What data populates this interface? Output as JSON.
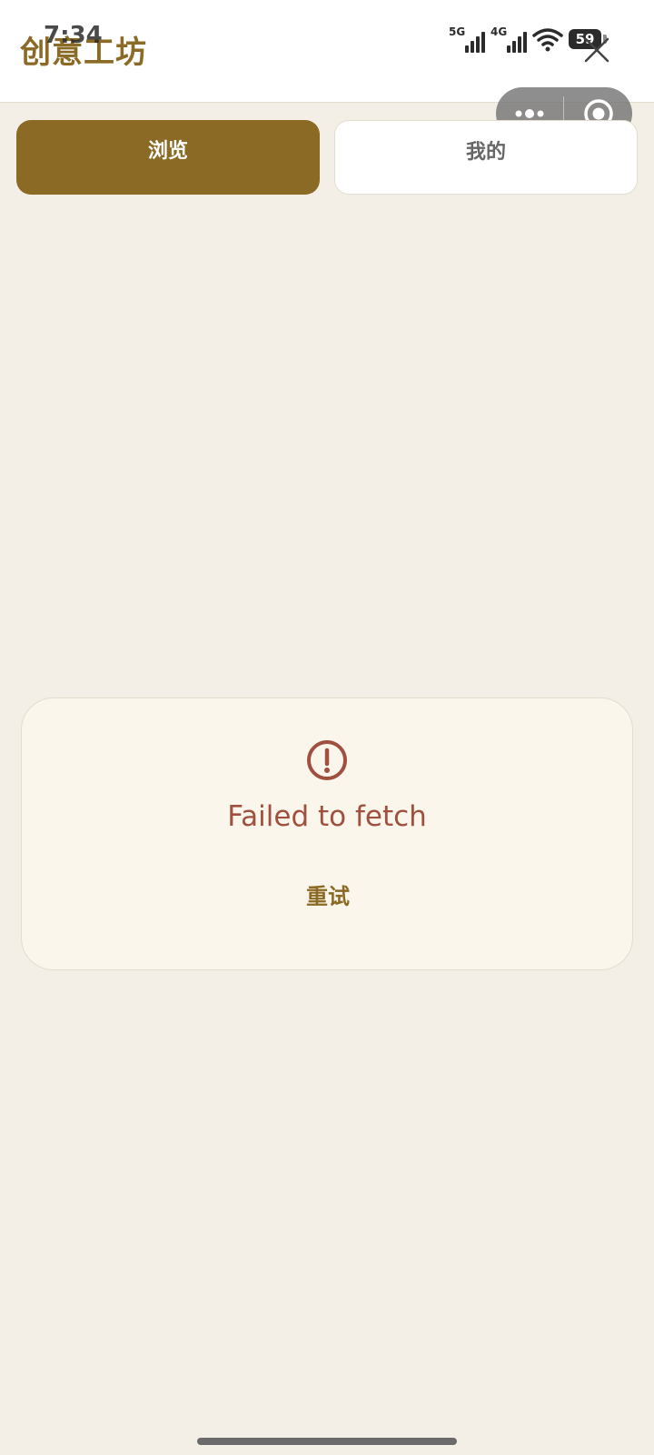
{
  "status_bar": {
    "time": "7:34",
    "network_1": "5G",
    "network_2": "4G",
    "battery": "59"
  },
  "header": {
    "title": "创意工坊"
  },
  "tabs": [
    {
      "label": "浏览",
      "active": true
    },
    {
      "label": "我的",
      "active": false
    }
  ],
  "error": {
    "message": "Failed to fetch",
    "retry_label": "重试"
  },
  "colors": {
    "accent": "#8a6a24",
    "background": "#f3efe7",
    "error": "#a0503f",
    "card": "#faf6ec"
  },
  "icons": {
    "close": "close-icon",
    "more": "more-dots-icon",
    "target": "target-icon",
    "error": "exclamation-circle-icon",
    "wifi": "wifi-icon"
  }
}
